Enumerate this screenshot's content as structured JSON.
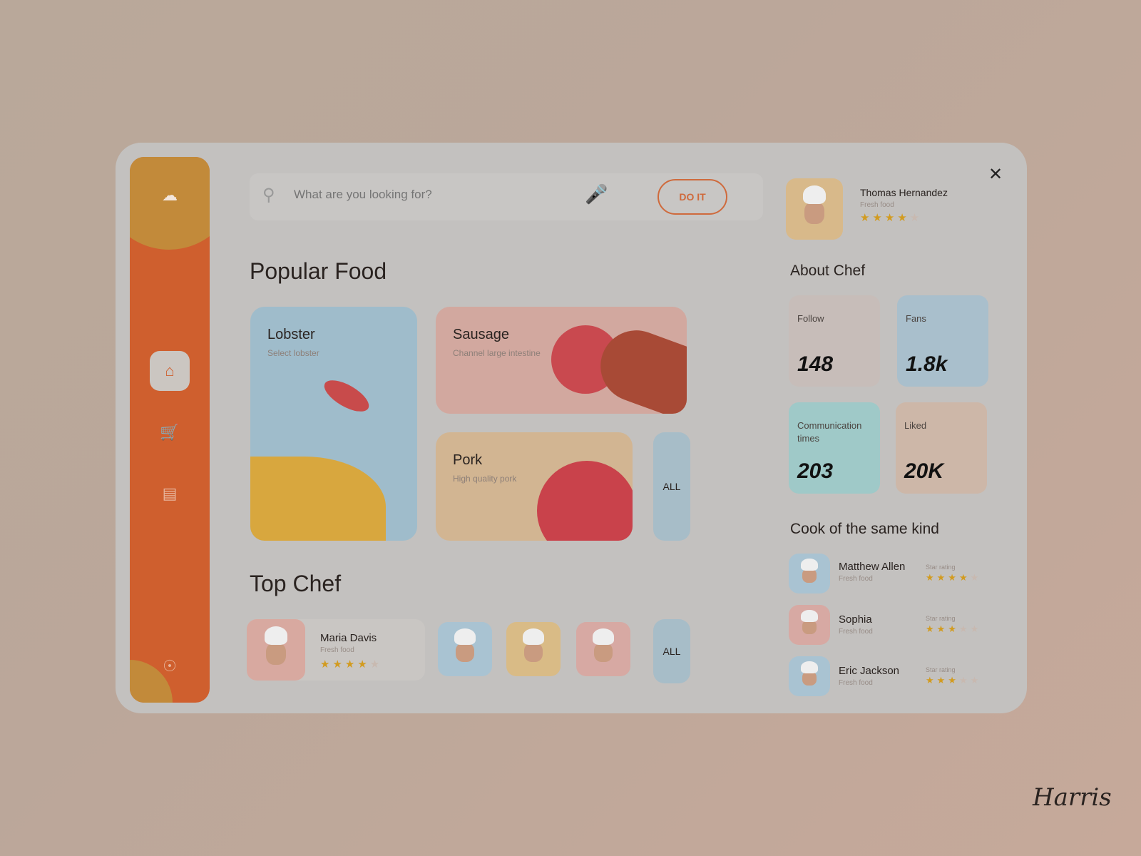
{
  "search": {
    "placeholder": "What are you looking for?",
    "button": "DO IT"
  },
  "sections": {
    "popular": "Popular Food",
    "top_chef": "Top Chef",
    "about": "About Chef",
    "same_kind": "Cook of the same kind"
  },
  "foods": [
    {
      "name": "Lobster",
      "desc": "Select lobster",
      "color": "#9fbccb"
    },
    {
      "name": "Sausage",
      "desc": "Channel large intestine",
      "color": "#d2a89f"
    },
    {
      "name": "Pork",
      "desc": "High quality pork",
      "color": "#d2b592"
    }
  ],
  "all_label": "ALL",
  "top_chef": {
    "name": "Maria Davis",
    "desc": "Fresh food",
    "rating": 4
  },
  "profile": {
    "name": "Thomas Hernandez",
    "desc": "Fresh food",
    "rating": 4
  },
  "stats": [
    {
      "label": "Follow",
      "value": "148",
      "color": "#c7bdb9"
    },
    {
      "label": "Fans",
      "value": "1.8k",
      "color": "#a9bfcc"
    },
    {
      "label": "Communication times",
      "value": "203",
      "color": "#9fc9c8"
    },
    {
      "label": "Liked",
      "value": "20K",
      "color": "#cdb7a8"
    }
  ],
  "cooks": [
    {
      "name": "Matthew Allen",
      "desc": "Fresh food",
      "rating_label": "Star rating",
      "rating": 4
    },
    {
      "name": "Sophia",
      "desc": "Fresh food",
      "rating_label": "Star rating",
      "rating": 3
    },
    {
      "name": "Eric Jackson",
      "desc": "Fresh food",
      "rating_label": "Star rating",
      "rating": 3
    }
  ],
  "signature": "Harris",
  "colors": {
    "accent": "#cf5f2e",
    "star": "#d29b1f"
  }
}
